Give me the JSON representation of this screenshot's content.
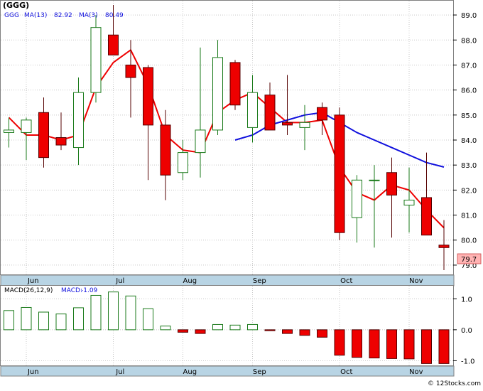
{
  "colors": {
    "up_candle": "#1a7a1a",
    "down_fill": "#ee0000",
    "down_stroke": "#550000",
    "ma_long": "#ee0000",
    "ma_short": "#1010dd",
    "macd_up": "#1a7a1a",
    "macd_down": "#ee0000",
    "axis_band": "#b8d4e4",
    "grid": "#c8c8c8",
    "last_price_box": "#ffb3b3"
  },
  "chart_data": [
    {
      "type": "candlestick",
      "title": "(GGG)",
      "legend": [
        {
          "label": "GGG",
          "color": "#1010dd"
        },
        {
          "label": "MA(13)",
          "value": "82.92",
          "color": "#1010dd"
        },
        {
          "label": "MA(3)",
          "value": "80.49",
          "color": "#1010dd"
        }
      ],
      "y_ticks": [
        "79.0",
        "80.0",
        "81.0",
        "82.0",
        "83.0",
        "84.0",
        "85.0",
        "86.0",
        "87.0",
        "88.0",
        "89.0"
      ],
      "ylim": [
        78.6,
        89.4
      ],
      "last_price_label": "79.7",
      "x_labels": [
        {
          "label": "Jun",
          "index": 1.4
        },
        {
          "label": "Jul",
          "index": 6.4
        },
        {
          "label": "Aug",
          "index": 10.4
        },
        {
          "label": "Sep",
          "index": 14.4
        },
        {
          "label": "Oct",
          "index": 19.4
        },
        {
          "label": "Nov",
          "index": 23.4
        }
      ],
      "x_gridlines": [
        1.0,
        6.0,
        10.0,
        14.0,
        19.0,
        23.0
      ],
      "candles": [
        {
          "o": 84.3,
          "h": 84.9,
          "l": 83.7,
          "c": 84.4
        },
        {
          "o": 84.3,
          "h": 84.9,
          "l": 83.2,
          "c": 84.8
        },
        {
          "o": 85.1,
          "h": 85.7,
          "l": 82.9,
          "c": 83.3
        },
        {
          "o": 84.1,
          "h": 85.1,
          "l": 83.6,
          "c": 83.8
        },
        {
          "o": 83.7,
          "h": 86.5,
          "l": 83.0,
          "c": 85.9
        },
        {
          "o": 85.9,
          "h": 89.0,
          "l": 85.5,
          "c": 88.5
        },
        {
          "o": 88.2,
          "h": 89.4,
          "l": 87.4,
          "c": 87.4
        },
        {
          "o": 87.0,
          "h": 88.0,
          "l": 84.9,
          "c": 86.5
        },
        {
          "o": 86.9,
          "h": 87.0,
          "l": 82.4,
          "c": 84.6
        },
        {
          "o": 84.6,
          "h": 85.2,
          "l": 81.6,
          "c": 82.6
        },
        {
          "o": 82.7,
          "h": 84.0,
          "l": 82.4,
          "c": 83.5
        },
        {
          "o": 83.5,
          "h": 87.7,
          "l": 82.5,
          "c": 84.4
        },
        {
          "o": 84.4,
          "h": 88.0,
          "l": 84.2,
          "c": 87.3
        },
        {
          "o": 87.1,
          "h": 87.2,
          "l": 85.2,
          "c": 85.4
        },
        {
          "o": 84.5,
          "h": 86.6,
          "l": 83.9,
          "c": 85.9
        },
        {
          "o": 85.8,
          "h": 86.3,
          "l": 84.4,
          "c": 84.4
        },
        {
          "o": 84.7,
          "h": 86.6,
          "l": 84.2,
          "c": 84.6
        },
        {
          "o": 84.5,
          "h": 85.4,
          "l": 83.6,
          "c": 84.7
        },
        {
          "o": 85.3,
          "h": 85.5,
          "l": 84.2,
          "c": 84.8
        },
        {
          "o": 85.0,
          "h": 85.3,
          "l": 80.0,
          "c": 80.3
        },
        {
          "o": 80.9,
          "h": 82.6,
          "l": 79.9,
          "c": 82.4
        },
        {
          "o": 82.4,
          "h": 83.0,
          "l": 79.7,
          "c": 82.4
        },
        {
          "o": 82.7,
          "h": 83.3,
          "l": 80.1,
          "c": 81.8
        },
        {
          "o": 81.4,
          "h": 82.9,
          "l": 80.3,
          "c": 81.6
        },
        {
          "o": 81.7,
          "h": 83.5,
          "l": 80.2,
          "c": 80.2
        },
        {
          "o": 79.8,
          "h": 80.8,
          "l": 78.8,
          "c": 79.7
        }
      ],
      "series": [
        {
          "name": "MA(13)",
          "color": "#1010dd",
          "values": [
            null,
            null,
            null,
            null,
            null,
            null,
            null,
            null,
            null,
            null,
            null,
            null,
            null,
            84.0,
            84.2,
            84.6,
            84.8,
            85.0,
            85.1,
            84.7,
            84.3,
            84.0,
            83.7,
            83.4,
            83.1,
            82.92
          ]
        }
      ],
      "ma_red": [
        84.9,
        84.2,
        84.2,
        84.0,
        84.2,
        86.1,
        87.1,
        87.6,
        86.2,
        84.2,
        83.6,
        83.5,
        85.1,
        85.6,
        85.9,
        85.3,
        84.7,
        84.7,
        84.8,
        82.9,
        81.9,
        81.6,
        82.2,
        82.0,
        81.2,
        80.49
      ]
    },
    {
      "type": "bar",
      "title": "MACD(26,12,9)",
      "legend": [
        {
          "label": "MACD(26,12,9)",
          "color": "#000000"
        },
        {
          "label": "MACD:",
          "value": "-1.09",
          "color": "#1010dd"
        }
      ],
      "y_ticks": [
        "-1.0",
        "0.0",
        "1.0"
      ],
      "ylim": [
        -1.15,
        1.35
      ],
      "values": [
        0.62,
        0.72,
        0.57,
        0.51,
        0.71,
        1.11,
        1.22,
        1.09,
        0.68,
        0.12,
        -0.08,
        -0.12,
        0.17,
        0.15,
        0.17,
        -0.03,
        -0.12,
        -0.18,
        -0.24,
        -0.82,
        -0.89,
        -0.91,
        -0.93,
        -0.94,
        -1.09,
        -1.09
      ]
    }
  ],
  "watermark": "© 12Stocks.com"
}
